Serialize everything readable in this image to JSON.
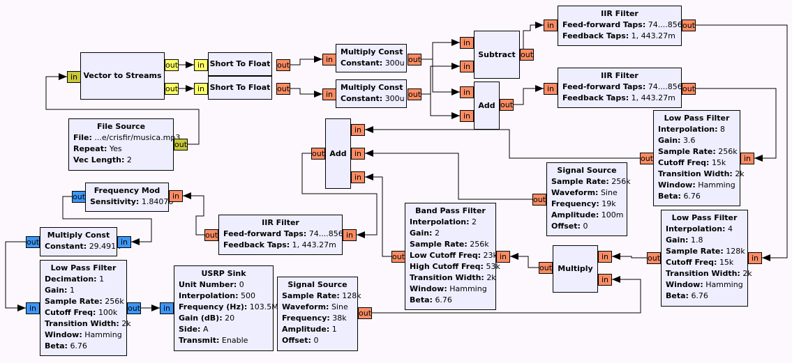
{
  "colors": {
    "float": "#fa8c64",
    "short": "#ffff66",
    "byte": "#c8c83a",
    "complex": "#3d96f5",
    "block_fill": "#eeeefe",
    "background": "#fdf8fd"
  },
  "blocks": [
    {
      "id": "vector-to-streams",
      "title": "Vector to Streams",
      "params": [],
      "ports": [
        {
          "label": "in",
          "type": "byte"
        },
        {
          "label": "out",
          "type": "short"
        },
        {
          "label": "out",
          "type": "short"
        }
      ]
    },
    {
      "id": "short-to-float-1",
      "title": "Short To Float",
      "params": [],
      "ports": [
        {
          "label": "in",
          "type": "short"
        },
        {
          "label": "out",
          "type": "float"
        }
      ]
    },
    {
      "id": "short-to-float-2",
      "title": "Short To Float",
      "params": [],
      "ports": [
        {
          "label": "in",
          "type": "short"
        },
        {
          "label": "out",
          "type": "float"
        }
      ]
    },
    {
      "id": "file-source",
      "title": "File Source",
      "params": [
        {
          "k": "File:",
          "v": "...e/crisfir/musica.mp3"
        },
        {
          "k": "Repeat:",
          "v": "Yes"
        },
        {
          "k": "Vec Length:",
          "v": "2"
        }
      ],
      "ports": [
        {
          "label": "out",
          "type": "byte"
        }
      ]
    },
    {
      "id": "multiply-const-1",
      "title": "Multiply Const",
      "params": [
        {
          "k": "Constant:",
          "v": "300u"
        }
      ],
      "ports": [
        {
          "label": "in",
          "type": "float"
        },
        {
          "label": "out",
          "type": "float"
        }
      ]
    },
    {
      "id": "multiply-const-2",
      "title": "Multiply Const",
      "params": [
        {
          "k": "Constant:",
          "v": "300u"
        }
      ],
      "ports": [
        {
          "label": "in",
          "type": "float"
        },
        {
          "label": "out",
          "type": "float"
        }
      ]
    },
    {
      "id": "subtract",
      "title": "Subtract",
      "params": [],
      "ports": [
        {
          "label": "in",
          "type": "float"
        },
        {
          "label": "in",
          "type": "float"
        },
        {
          "label": "out",
          "type": "float"
        }
      ]
    },
    {
      "id": "add-1",
      "title": "Add",
      "params": [],
      "ports": [
        {
          "label": "in",
          "type": "float"
        },
        {
          "label": "in",
          "type": "float"
        },
        {
          "label": "out",
          "type": "float"
        }
      ]
    },
    {
      "id": "iir-filter-1",
      "title": "IIR Filter",
      "params": [
        {
          "k": "Feed-forward Taps:",
          "v": "74....856m"
        },
        {
          "k": "Feedback Taps:",
          "v": "1, 443.27m"
        }
      ],
      "ports": [
        {
          "label": "in",
          "type": "float"
        },
        {
          "label": "out",
          "type": "float"
        }
      ]
    },
    {
      "id": "iir-filter-2",
      "title": "IIR Filter",
      "params": [
        {
          "k": "Feed-forward Taps:",
          "v": "74....856m"
        },
        {
          "k": "Feedback Taps:",
          "v": "1, 443.27m"
        }
      ],
      "ports": [
        {
          "label": "in",
          "type": "float"
        },
        {
          "label": "out",
          "type": "float"
        }
      ]
    },
    {
      "id": "low-pass-filter-interp8",
      "title": "Low Pass Filter",
      "params": [
        {
          "k": "Interpolation:",
          "v": "8"
        },
        {
          "k": "Gain:",
          "v": "3.6"
        },
        {
          "k": "Sample Rate:",
          "v": "256k"
        },
        {
          "k": "Cutoff Freq:",
          "v": "15k"
        },
        {
          "k": "Transition Width:",
          "v": "2k"
        },
        {
          "k": "Window:",
          "v": "Hamming"
        },
        {
          "k": "Beta:",
          "v": "6.76"
        }
      ],
      "ports": [
        {
          "label": "in",
          "type": "float"
        },
        {
          "label": "out",
          "type": "float"
        }
      ]
    },
    {
      "id": "add-2",
      "title": "Add",
      "params": [],
      "ports": [
        {
          "label": "in",
          "type": "float"
        },
        {
          "label": "in",
          "type": "float"
        },
        {
          "label": "in",
          "type": "float"
        },
        {
          "label": "out",
          "type": "float"
        }
      ]
    },
    {
      "id": "signal-source-19k",
      "title": "Signal Source",
      "params": [
        {
          "k": "Sample Rate:",
          "v": "256k"
        },
        {
          "k": "Waveform:",
          "v": "Sine"
        },
        {
          "k": "Frequency:",
          "v": "19k"
        },
        {
          "k": "Amplitude:",
          "v": "100m"
        },
        {
          "k": "Offset:",
          "v": "0"
        }
      ],
      "ports": [
        {
          "label": "out",
          "type": "float"
        }
      ]
    },
    {
      "id": "frequency-mod",
      "title": "Frequency Mod",
      "params": [
        {
          "k": "Sensitivity:",
          "v": "1.84078"
        }
      ],
      "ports": [
        {
          "label": "out",
          "type": "complex"
        },
        {
          "label": "in",
          "type": "float"
        }
      ]
    },
    {
      "id": "iir-filter-3",
      "title": "IIR Filter",
      "params": [
        {
          "k": "Feed-forward Taps:",
          "v": "74....856m"
        },
        {
          "k": "Feedback Taps:",
          "v": "1, 443.27m"
        }
      ],
      "ports": [
        {
          "label": "out",
          "type": "float"
        },
        {
          "label": "in",
          "type": "float"
        }
      ]
    },
    {
      "id": "band-pass-filter",
      "title": "Band Pass Filter",
      "params": [
        {
          "k": "Interpolation:",
          "v": "2"
        },
        {
          "k": "Gain:",
          "v": "2"
        },
        {
          "k": "Sample Rate:",
          "v": "256k"
        },
        {
          "k": "Low Cutoff Freq:",
          "v": "23k"
        },
        {
          "k": "High Cutoff Freq:",
          "v": "53k"
        },
        {
          "k": "Transition Width:",
          "v": "2k"
        },
        {
          "k": "Window:",
          "v": "Hamming"
        },
        {
          "k": "Beta:",
          "v": "6.76"
        }
      ],
      "ports": [
        {
          "label": "in",
          "type": "float"
        },
        {
          "label": "out",
          "type": "float"
        }
      ]
    },
    {
      "id": "low-pass-filter-interp4",
      "title": "Low Pass Filter",
      "params": [
        {
          "k": "Interpolation:",
          "v": "4"
        },
        {
          "k": "Gain:",
          "v": "1.8"
        },
        {
          "k": "Sample Rate:",
          "v": "128k"
        },
        {
          "k": "Cutoff Freq:",
          "v": "15k"
        },
        {
          "k": "Transition Width:",
          "v": "2k"
        },
        {
          "k": "Window:",
          "v": "Hamming"
        },
        {
          "k": "Beta:",
          "v": "6.76"
        }
      ],
      "ports": [
        {
          "label": "out",
          "type": "float"
        },
        {
          "label": "in",
          "type": "float"
        }
      ]
    },
    {
      "id": "multiply",
      "title": "Multiply",
      "params": [],
      "ports": [
        {
          "label": "in",
          "type": "float"
        },
        {
          "label": "in",
          "type": "float"
        },
        {
          "label": "out",
          "type": "float"
        }
      ]
    },
    {
      "id": "multiply-const-3",
      "title": "Multiply Const",
      "params": [
        {
          "k": "Constant:",
          "v": "29.491k"
        }
      ],
      "ports": [
        {
          "label": "out",
          "type": "complex"
        },
        {
          "label": "in",
          "type": "complex"
        }
      ]
    },
    {
      "id": "low-pass-filter-decim",
      "title": "Low Pass Filter",
      "params": [
        {
          "k": "Decimation:",
          "v": "1"
        },
        {
          "k": "Gain:",
          "v": "1"
        },
        {
          "k": "Sample Rate:",
          "v": "256k"
        },
        {
          "k": "Cutoff Freq:",
          "v": "100k"
        },
        {
          "k": "Transition Width:",
          "v": "2k"
        },
        {
          "k": "Window:",
          "v": "Hamming"
        },
        {
          "k": "Beta:",
          "v": "6.76"
        }
      ],
      "ports": [
        {
          "label": "in",
          "type": "complex"
        },
        {
          "label": "out",
          "type": "complex"
        }
      ]
    },
    {
      "id": "usrp-sink",
      "title": "USRP Sink",
      "params": [
        {
          "k": "Unit Number:",
          "v": "0"
        },
        {
          "k": "Interpolation:",
          "v": "500"
        },
        {
          "k": "Frequency (Hz):",
          "v": "103.5M"
        },
        {
          "k": "Gain (dB):",
          "v": "20"
        },
        {
          "k": "Side:",
          "v": "A"
        },
        {
          "k": "Transmit:",
          "v": "Enable"
        }
      ],
      "ports": [
        {
          "label": "in",
          "type": "complex"
        }
      ]
    },
    {
      "id": "signal-source-38k",
      "title": "Signal Source",
      "params": [
        {
          "k": "Sample Rate:",
          "v": "128k"
        },
        {
          "k": "Waveform:",
          "v": "Sine"
        },
        {
          "k": "Frequency:",
          "v": "38k"
        },
        {
          "k": "Amplitude:",
          "v": "1"
        },
        {
          "k": "Offset:",
          "v": "0"
        }
      ],
      "ports": [
        {
          "label": "out",
          "type": "float"
        }
      ]
    }
  ]
}
